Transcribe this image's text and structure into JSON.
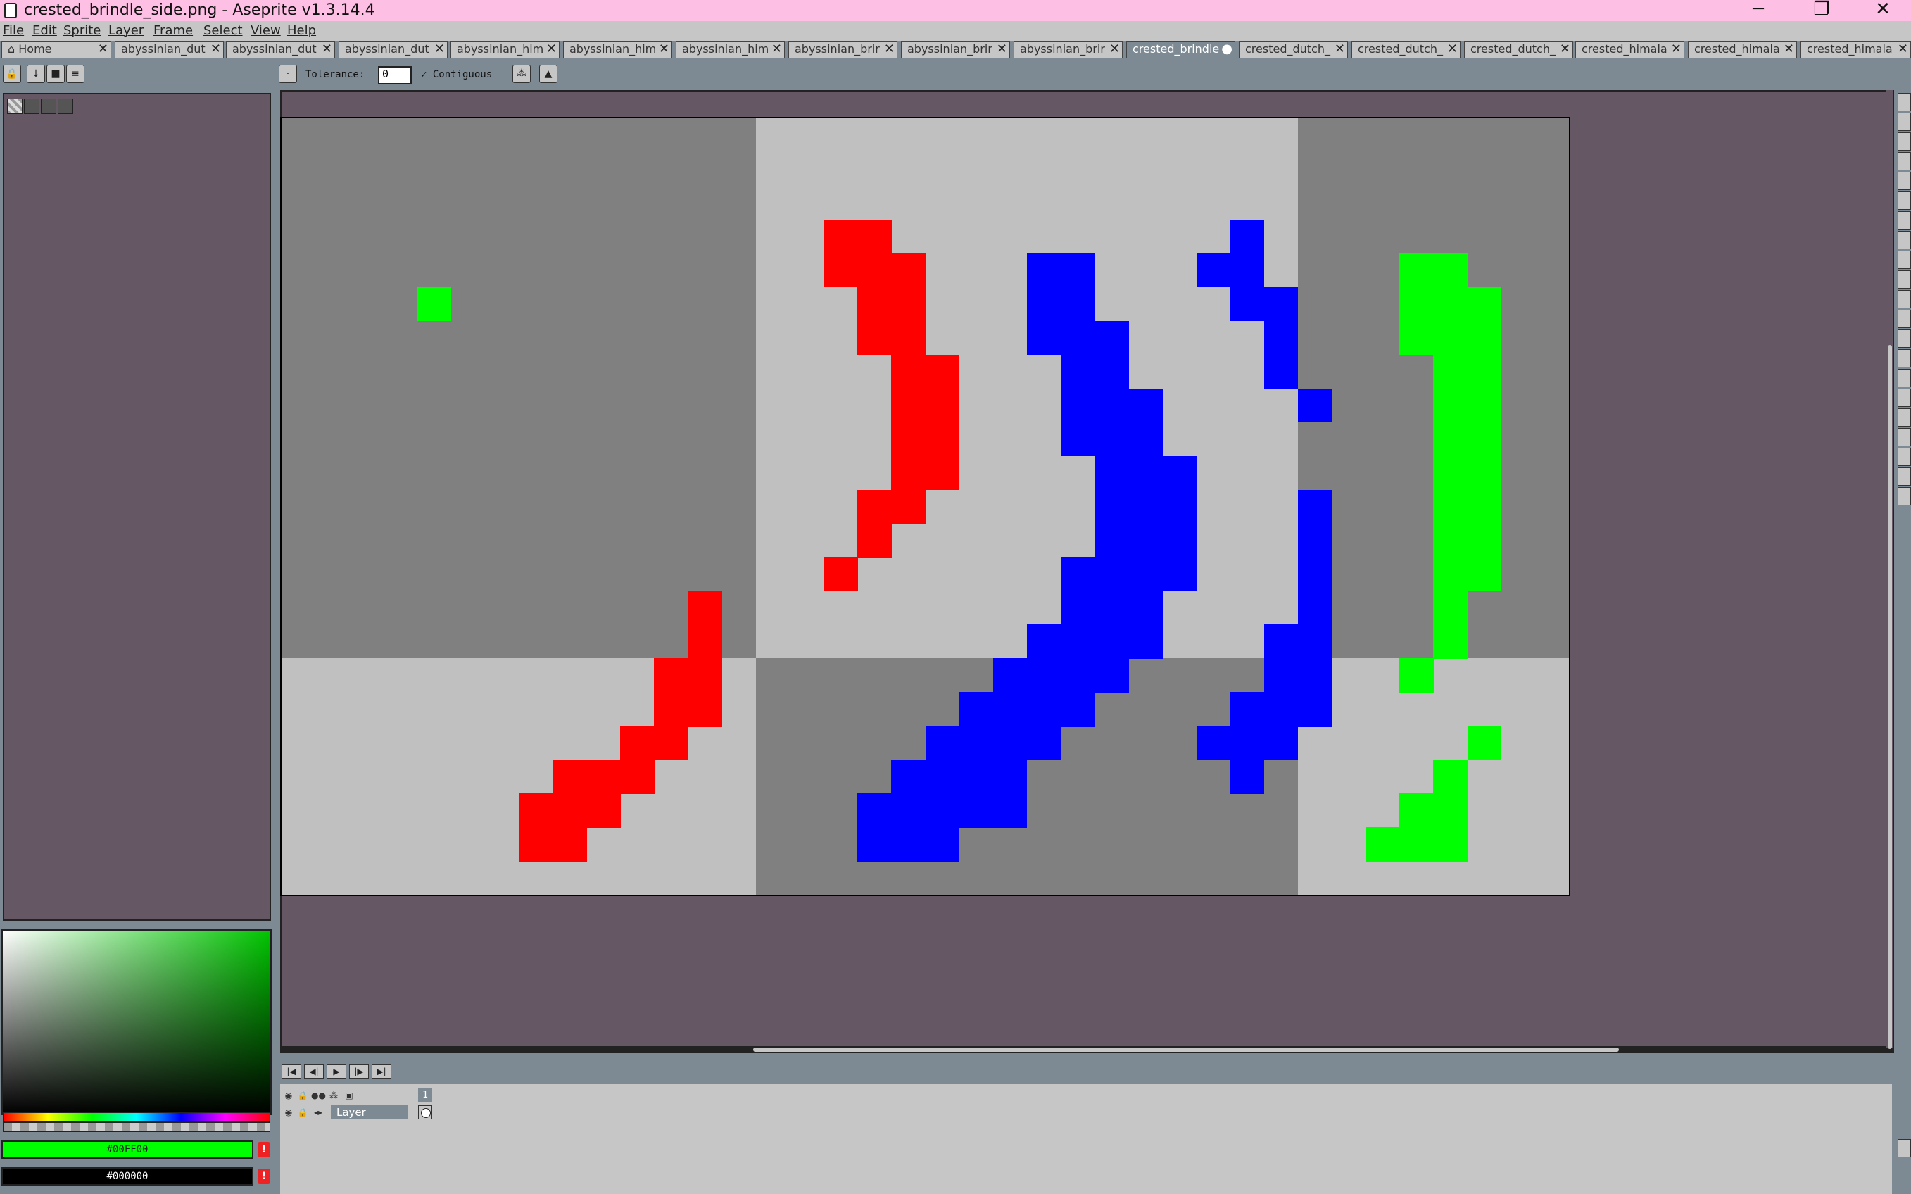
{
  "window": {
    "title": "crested_brindle_side.png - Aseprite v1.3.14.4",
    "minimize": "─",
    "maximize": "❐",
    "close": "✕"
  },
  "menu": [
    "File",
    "Edit",
    "Sprite",
    "Layer",
    "Frame",
    "Select",
    "View",
    "Help"
  ],
  "tabs": [
    {
      "label": "⌂ Home",
      "active": false
    },
    {
      "label": "abyssinian_dut",
      "active": false
    },
    {
      "label": "abyssinian_dut",
      "active": false
    },
    {
      "label": "abyssinian_dut",
      "active": false
    },
    {
      "label": "abyssinian_him",
      "active": false
    },
    {
      "label": "abyssinian_him",
      "active": false
    },
    {
      "label": "abyssinian_him",
      "active": false
    },
    {
      "label": "abyssinian_brir",
      "active": false
    },
    {
      "label": "abyssinian_brir",
      "active": false
    },
    {
      "label": "abyssinian_brir",
      "active": false
    },
    {
      "label": "crested_brindle",
      "active": true
    },
    {
      "label": "crested_dutch_",
      "active": false
    },
    {
      "label": "crested_dutch_",
      "active": false
    },
    {
      "label": "crested_dutch_",
      "active": false
    },
    {
      "label": "crested_himala",
      "active": false
    },
    {
      "label": "crested_himala",
      "active": false
    },
    {
      "label": "crested_himala",
      "active": false
    }
  ],
  "tab_close": "✕",
  "tab_modified": "●",
  "context": {
    "tolerance_label": "Tolerance:",
    "tolerance_value": "0",
    "contiguous_label": "✓ Contiguous"
  },
  "colors": {
    "foreground_hex": "#00FF00",
    "background_hex": "#000000",
    "warning": "!"
  },
  "timeline": {
    "layer_name": "Layer",
    "frame_number": "1"
  },
  "sprite": {
    "grid_cols": 38,
    "grid_rows": 23,
    "checker_dark": "#808080",
    "checker_light": "#c0c0c0",
    "red": "#ff0000",
    "blue": "#0000ff",
    "green": "#00ff00"
  }
}
